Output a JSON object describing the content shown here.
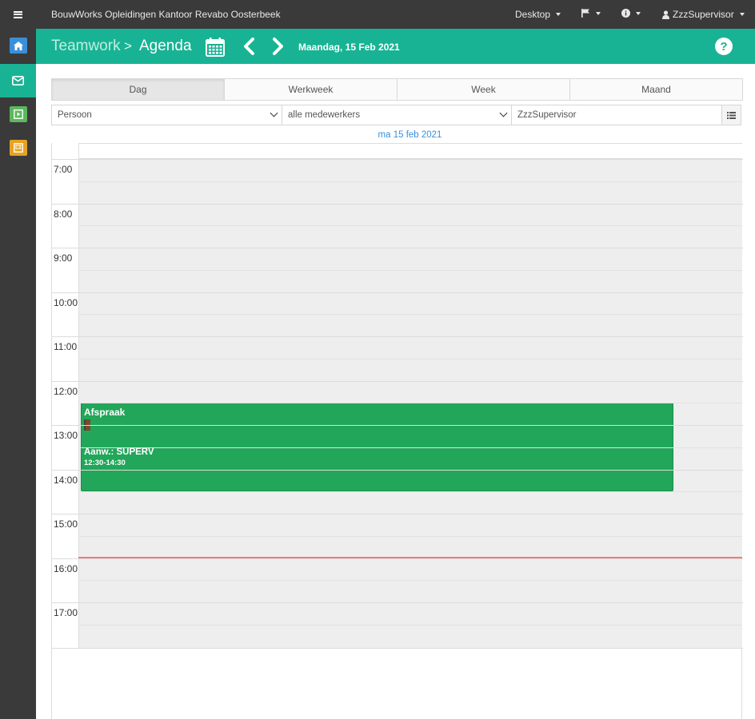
{
  "topbar": {
    "org": "BouwWorks Opleidingen Kantoor Revabo Oosterbeek",
    "desktop": "Desktop",
    "user": "ZzzSupervisor"
  },
  "sidebar": {
    "items": [
      {
        "icon": "home-icon",
        "color": "#3b8fd9"
      },
      {
        "icon": "envelope-icon",
        "color": "#18b394"
      },
      {
        "icon": "play-square-icon",
        "color": "#5cb85c"
      },
      {
        "icon": "flag-square-icon",
        "color": "#e6a321"
      }
    ]
  },
  "header": {
    "breadcrumb_parent": "Teamwork",
    "breadcrumb_separator": ">",
    "title": "Agenda",
    "current_date": "Maandag, 15 Feb 2021",
    "help": "?"
  },
  "tabs": [
    {
      "label": "Dag",
      "active": true
    },
    {
      "label": "Werkweek",
      "active": false
    },
    {
      "label": "Week",
      "active": false
    },
    {
      "label": "Maand",
      "active": false
    }
  ],
  "filters": {
    "type": "Persoon",
    "group": "alle medewerkers",
    "person": "ZzzSupervisor"
  },
  "calendar": {
    "day_label": "ma 15 feb 2021",
    "hours": [
      "7:00",
      "8:00",
      "9:00",
      "10:00",
      "11:00",
      "12:00",
      "13:00",
      "14:00",
      "15:00",
      "16:00",
      "17:00"
    ],
    "now_time": "15:58",
    "event": {
      "title": "Afspraak",
      "subtitle": "Aanw.: SUPERV",
      "time": "12:30-14:30",
      "color": "#22a65a"
    }
  },
  "colors": {
    "accent": "#18b394",
    "topbar": "#3a3a3a",
    "now_line": "#ee7b7b"
  }
}
